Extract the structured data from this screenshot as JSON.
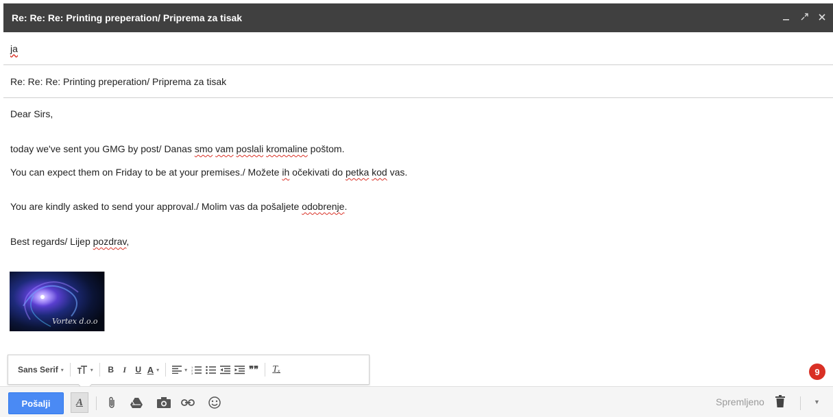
{
  "window": {
    "title": "Re: Re: Re: Printing preperation/ Priprema za tisak",
    "controls": [
      "_",
      "↗",
      "✕"
    ]
  },
  "to_field": {
    "recipient": "ja"
  },
  "subject_field": {
    "value": "Re: Re: Re: Printing preperation/ Priprema za tisak"
  },
  "body": {
    "greeting": "Dear Sirs,",
    "line1": {
      "a": "today we've sent you GMG by post/ Danas ",
      "w1": "smo",
      "s1": " ",
      "w2": "vam",
      "s2": " ",
      "w3": "poslali",
      "s3": " ",
      "w4": "kromaline",
      "b": " poštom."
    },
    "line2": {
      "a": "You can expect them on Friday to be at your premises./ Možete ",
      "w1": "ih",
      "b": " očekivati do ",
      "w2": "petka",
      "s2": " ",
      "w3": "kod",
      "c": " vas."
    },
    "line3": {
      "a": "You are kindly asked to send your approval./ Molim vas da pošaljete ",
      "w1": "odobrenje",
      "b": "."
    },
    "line4": {
      "a": "Best regards/ Lijep ",
      "w1": "pozdrav",
      "b": ","
    },
    "signature_text": "Vortex d.o.o"
  },
  "format_toolbar": {
    "font": "Sans Serif",
    "caret": "▾",
    "size_icon": "text-size-icon",
    "bold": "B",
    "italic": "I",
    "underline": "U",
    "text_color": "A",
    "quote": "❞❞",
    "clear": "Tₓ"
  },
  "badge": {
    "count": "9"
  },
  "bottom_bar": {
    "send_label": "Pošalji",
    "format_toggle": "A",
    "saved_label": "Spremljeno",
    "more_caret": "▼"
  },
  "colors": {
    "send_button": "#4a8af4",
    "title_bar": "#404040",
    "badge": "#d93025",
    "spell_underline": "#d93025"
  }
}
